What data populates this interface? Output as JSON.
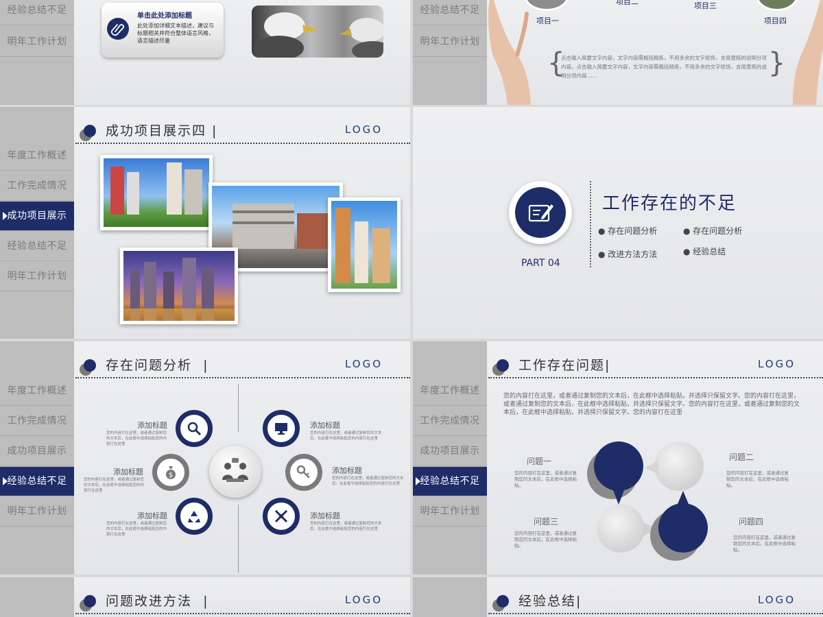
{
  "nav": [
    "年度工作概述",
    "工作完成情况",
    "成功项目展示",
    "经验总结不足",
    "明年工作计划"
  ],
  "logo": "LOGO",
  "slide1": {
    "card_title": "单击此处添加标题",
    "card_text": "此处添加详细文本描述，建议与标题相关并符合整体语言风格，语言描述尽量"
  },
  "slide2": {
    "items": [
      "项目一",
      "项目二",
      "项目三",
      "项目四"
    ],
    "quote": "点击输入简要文字内容，文字内容需概括精炼，不用多余的文字修饰，言简意赅的说明分项内容。点击输入简要文字内容，文字内容需概括精炼，不用多余的文字修饰，言简意赅的说明分项内容……"
  },
  "slide3": {
    "title": "成功项目展示四"
  },
  "slide4": {
    "part": "PART 04",
    "title": "工作存在的不足",
    "bullets": [
      "存在问题分析",
      "存在问题分析",
      "改进方法方法",
      "经验总结"
    ]
  },
  "slide5": {
    "title": "存在问题分析",
    "item_title": "添加标题",
    "item_text": "您的内容打在这里，或者通过复制您的文本后，在此框中选择粘贴您的内容打在这里"
  },
  "slide6": {
    "title": "工作存在问题",
    "intro": "您的内容打在这里，或者通过复制您的文本后，在此框中选择粘贴，并选择只保留文字。您的内容打在这里，或者通过复制您的文本后，在此框中选择粘贴，并选择只保留文字。您的内容打在这里，或者通过复制您的文本后，在此框中选择粘贴，并选择只保留文字。您的内容打在这里",
    "problems": [
      "问题一",
      "问题二",
      "问题三",
      "问题四"
    ],
    "problem_text": "您的内容打在这里，或者通过复制您的文本后，在此框中选择粘贴。"
  },
  "slide7": {
    "title": "问题改进方法"
  },
  "slide8": {
    "title": "经验总结"
  },
  "colors": {
    "navy": "#1e2c68",
    "gray": "#7a7a7a",
    "sidebar": "#bdbdbd"
  },
  "icons": [
    "paperclip-icon",
    "edit-document-icon",
    "magnifier-icon",
    "monitor-icon",
    "money-bag-icon",
    "key-icon",
    "recycle-icon",
    "tools-icon",
    "meeting-people-icon"
  ]
}
